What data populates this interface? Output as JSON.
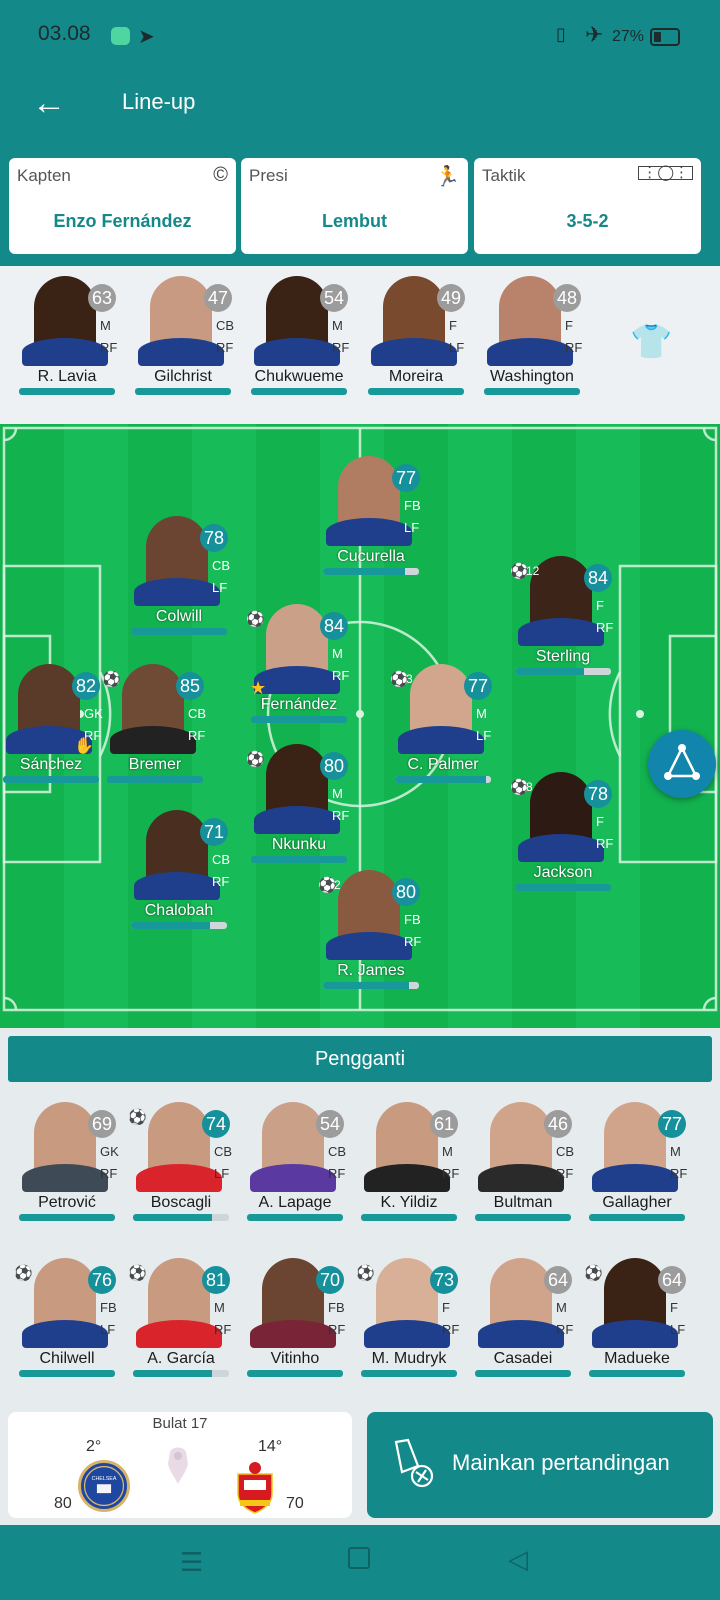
{
  "status_bar": {
    "time": "03.08",
    "battery": "27%"
  },
  "header": {
    "title": "Line-up"
  },
  "cards": [
    {
      "label": "Kapten",
      "value": "Enzo Fernández",
      "icon": "copyright-icon"
    },
    {
      "label": "Presi",
      "value": "Lembut",
      "icon": "running-icon"
    },
    {
      "label": "Taktik",
      "value": "3-5-2",
      "icon": "pitch-icon"
    }
  ],
  "reserves": [
    {
      "name": "R. Lavia",
      "rating": "63",
      "pos": "M",
      "foot": "RF",
      "rating_color": "#9c9c9c",
      "skin": "#3a2215"
    },
    {
      "name": "Gilchrist",
      "rating": "47",
      "pos": "CB",
      "foot": "RF",
      "rating_color": "#9c9c9c",
      "skin": "#c99a82"
    },
    {
      "name": "Chukwueme",
      "rating": "54",
      "pos": "M",
      "foot": "RF",
      "rating_color": "#9c9c9c",
      "skin": "#3a2215"
    },
    {
      "name": "Moreira",
      "rating": "49",
      "pos": "F",
      "foot": "LF",
      "rating_color": "#9c9c9c",
      "skin": "#7a4a2e"
    },
    {
      "name": "Washington",
      "rating": "48",
      "pos": "F",
      "foot": "RF",
      "rating_color": "#9c9c9c",
      "skin": "#b8836a"
    }
  ],
  "lineup": [
    {
      "name": "Cucurella",
      "rating": "77",
      "pos": "FB",
      "foot": "LF",
      "stamina": 0.85,
      "rating_color": "#16909a",
      "skin": "#b07d62"
    },
    {
      "name": "Colwill",
      "rating": "78",
      "pos": "CB",
      "foot": "LF",
      "stamina": 1.0,
      "rating_color": "#16909a",
      "skin": "#6b4532"
    },
    {
      "name": "Sterling",
      "rating": "84",
      "pos": "F",
      "foot": "RF",
      "stamina": 0.72,
      "rating_color": "#16909a",
      "skin": "#3c2418",
      "ball": true,
      "goals": "12"
    },
    {
      "name": "Fernández",
      "rating": "84",
      "pos": "M",
      "foot": "RF",
      "stamina": 1.0,
      "rating_color": "#16909a",
      "skin": "#caa088",
      "ball": true,
      "captain": true
    },
    {
      "name": "Sánchez",
      "rating": "82",
      "pos": "GK",
      "foot": "RF",
      "stamina": 1.0,
      "rating_color": "#16909a",
      "skin": "#5a3a28",
      "glove": true
    },
    {
      "name": "Bremer",
      "rating": "85",
      "pos": "CB",
      "foot": "RF",
      "stamina": 1.0,
      "rating_color": "#16909a",
      "skin": "#6f4a34",
      "ball": true,
      "kit": "#222222"
    },
    {
      "name": "C. Palmer",
      "rating": "77",
      "pos": "M",
      "foot": "LF",
      "stamina": 0.95,
      "rating_color": "#16909a",
      "skin": "#d2a68d",
      "ball": true,
      "goals": "3"
    },
    {
      "name": "Nkunku",
      "rating": "80",
      "pos": "M",
      "foot": "RF",
      "stamina": 1.0,
      "rating_color": "#16909a",
      "skin": "#3a2215",
      "ball": true
    },
    {
      "name": "Jackson",
      "rating": "78",
      "pos": "F",
      "foot": "RF",
      "stamina": 1.0,
      "rating_color": "#16909a",
      "skin": "#2d1a12",
      "ball": true,
      "goals": "8"
    },
    {
      "name": "Chalobah",
      "rating": "71",
      "pos": "CB",
      "foot": "RF",
      "stamina": 0.82,
      "rating_color": "#16909a",
      "skin": "#4a2e20"
    },
    {
      "name": "R. James",
      "rating": "80",
      "pos": "FB",
      "foot": "RF",
      "stamina": 0.9,
      "rating_color": "#16909a",
      "skin": "#8a5a40",
      "ball": true,
      "goals": "2"
    }
  ],
  "substitutes": {
    "title": "Pengganti",
    "players": [
      {
        "name": "Petrović",
        "rating": "69",
        "pos": "GK",
        "foot": "RF",
        "stamina": 1.0,
        "rating_color": "#9c9c9c",
        "skin": "#c89a80",
        "kit": "#3e4a56"
      },
      {
        "name": "Boscagli",
        "rating": "74",
        "pos": "CB",
        "foot": "LF",
        "stamina": 0.82,
        "rating_color": "#16909a",
        "skin": "#c89a80",
        "ball": true,
        "kit": "#d9242b"
      },
      {
        "name": "A. Lapage",
        "rating": "54",
        "pos": "CB",
        "foot": "RF",
        "stamina": 1.0,
        "rating_color": "#9c9c9c",
        "skin": "#caa088",
        "kit": "#5a3aa0"
      },
      {
        "name": "K. Yildiz",
        "rating": "61",
        "pos": "M",
        "foot": "RF",
        "stamina": 1.0,
        "rating_color": "#9c9c9c",
        "skin": "#c89a80",
        "kit": "#222222"
      },
      {
        "name": "Bultman",
        "rating": "46",
        "pos": "CB",
        "foot": "RF",
        "stamina": 1.0,
        "rating_color": "#9c9c9c",
        "skin": "#d0a48a",
        "kit": "#2a2a2a"
      },
      {
        "name": "Gallagher",
        "rating": "77",
        "pos": "M",
        "foot": "RF",
        "stamina": 1.0,
        "rating_color": "#16909a",
        "skin": "#d0a48a"
      },
      {
        "name": "Chilwell",
        "rating": "76",
        "pos": "FB",
        "foot": "LF",
        "stamina": 1.0,
        "rating_color": "#16909a",
        "skin": "#c89a80",
        "ball": true
      },
      {
        "name": "A. García",
        "rating": "81",
        "pos": "M",
        "foot": "RF",
        "stamina": 0.82,
        "rating_color": "#16909a",
        "skin": "#c89a80",
        "ball": true,
        "kit": "#d9242b"
      },
      {
        "name": "Vitinho",
        "rating": "70",
        "pos": "FB",
        "foot": "RF",
        "stamina": 1.0,
        "rating_color": "#16909a",
        "skin": "#6b4532",
        "kit": "#7a2438"
      },
      {
        "name": "M. Mudryk",
        "rating": "73",
        "pos": "F",
        "foot": "RF",
        "stamina": 1.0,
        "rating_color": "#16909a",
        "skin": "#d8b098",
        "ball": true
      },
      {
        "name": "Casadei",
        "rating": "64",
        "pos": "M",
        "foot": "RF",
        "stamina": 1.0,
        "rating_color": "#9c9c9c",
        "skin": "#d0a48a"
      },
      {
        "name": "Madueke",
        "rating": "64",
        "pos": "F",
        "foot": "LF",
        "stamina": 1.0,
        "rating_color": "#9c9c9c",
        "skin": "#3a2215",
        "ball": true
      }
    ]
  },
  "match": {
    "round": "Bulat 17",
    "home_form": "2°",
    "home_score": "80",
    "away_form": "14°",
    "away_score": "70",
    "home_crest_text": "CHELSEA"
  },
  "play_button": {
    "label": "Mainkan pertandingan"
  },
  "colors": {
    "primary": "#14898a",
    "pitch": "#12b24f",
    "pitch_stripe": "#17bb57",
    "rating_active": "#16909a",
    "rating_inactive": "#9c9c9c"
  }
}
